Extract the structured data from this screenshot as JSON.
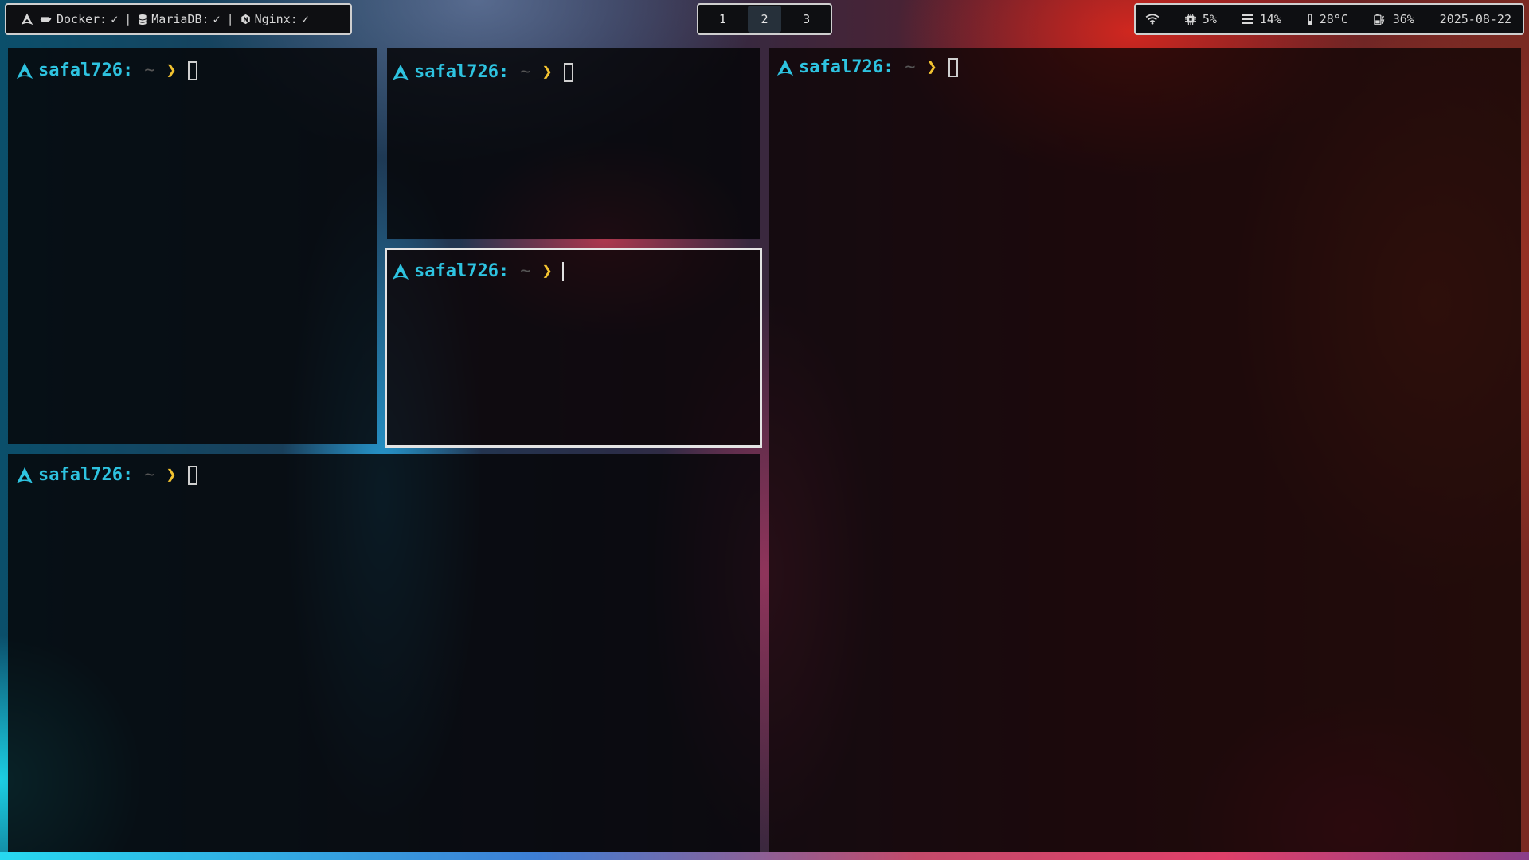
{
  "topbar": {
    "left": {
      "services": [
        {
          "name": "Docker",
          "label": "Docker:",
          "status": "✓",
          "icon": "whale-icon"
        },
        {
          "name": "MariaDB",
          "label": "MariaDB:",
          "status": "✓",
          "icon": "database-icon"
        },
        {
          "name": "Nginx",
          "label": "Nginx:",
          "status": "✓",
          "icon": "nginx-icon"
        }
      ],
      "separator": "|"
    },
    "workspaces": [
      {
        "label": "1",
        "active": false
      },
      {
        "label": "2",
        "active": true
      },
      {
        "label": "3",
        "active": false
      }
    ],
    "right": {
      "cpu": "5%",
      "memory": "14%",
      "temperature": "28°C",
      "battery": "36%",
      "date": "2025-08-22"
    }
  },
  "terminals": [
    {
      "id": "top-left",
      "user": "safal726:",
      "path": "~",
      "chevron": "❯",
      "focused": false
    },
    {
      "id": "top-middle",
      "user": "safal726:",
      "path": "~",
      "chevron": "❯",
      "focused": false
    },
    {
      "id": "middle-focused",
      "user": "safal726:",
      "path": "~",
      "chevron": "❯",
      "focused": true
    },
    {
      "id": "bottom-left",
      "user": "safal726:",
      "path": "~",
      "chevron": "❯",
      "focused": false
    },
    {
      "id": "right",
      "user": "safal726:",
      "path": "~",
      "chevron": "❯",
      "focused": false
    }
  ],
  "colors": {
    "prompt_user": "#2ec3e0",
    "chevron": "#f2c230",
    "bar_border": "#cfcfcf",
    "bar_bg": "#0e0f12"
  }
}
